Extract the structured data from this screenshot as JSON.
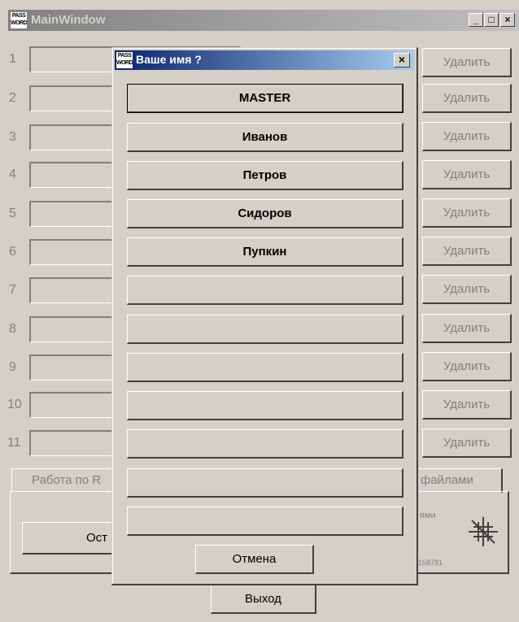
{
  "main": {
    "title": "MainWindow",
    "icon_text": "PASS WORD",
    "minimize": "_",
    "maximize": "□",
    "close": "×",
    "rows": [
      {
        "num": "1",
        "delete": "Удалить"
      },
      {
        "num": "2",
        "delete": "Удалить"
      },
      {
        "num": "3",
        "delete": "Удалить"
      },
      {
        "num": "4",
        "delete": "Удалить"
      },
      {
        "num": "5",
        "delete": "Удалить"
      },
      {
        "num": "6",
        "delete": "Удалить"
      },
      {
        "num": "7",
        "delete": "Удалить"
      },
      {
        "num": "8",
        "delete": "Удалить"
      },
      {
        "num": "9",
        "delete": "Удалить"
      },
      {
        "num": "10",
        "delete": "Удалить"
      },
      {
        "num": "11",
        "delete": "Удалить"
      }
    ],
    "tabs": [
      "Работа по R",
      "файлами"
    ],
    "panel_button": "Ост",
    "panel_text": "ями",
    "panel_number": "158781",
    "exit": "Выход"
  },
  "dialog": {
    "title": "Ваше имя ?",
    "icon_text": "PASS WORD",
    "close": "×",
    "names": [
      "MASTER",
      "Иванов",
      "Петров",
      "Сидоров",
      "Пупкин",
      "",
      "",
      "",
      "",
      "",
      "",
      ""
    ],
    "cancel": "Отмена"
  }
}
